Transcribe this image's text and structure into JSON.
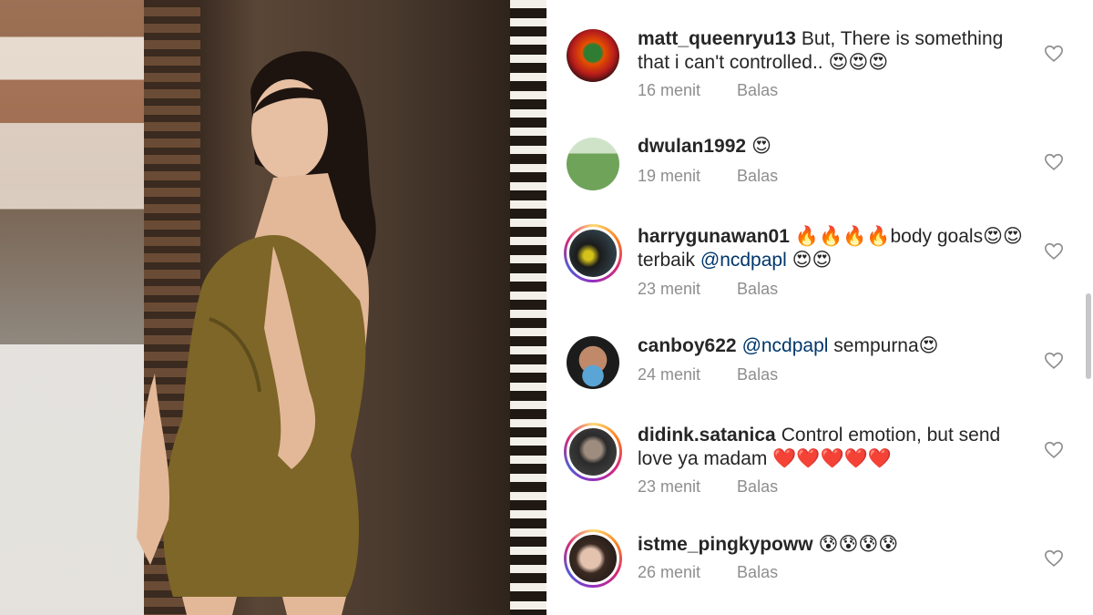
{
  "comments": [
    {
      "username": "matt_queenryu13",
      "segments": [
        {
          "text": "But, There is something that i can't controlled.. 😍😍😍"
        }
      ],
      "time": "16 menit",
      "reply": "Balas",
      "story_ring": false,
      "avatar": "red-fire-avatar"
    },
    {
      "username": "dwulan1992",
      "segments": [
        {
          "text": "😍"
        }
      ],
      "time": "19 menit",
      "reply": "Balas",
      "story_ring": false,
      "avatar": "child-on-grass-avatar"
    },
    {
      "username": "harrygunawan01",
      "segments": [
        {
          "text": "🔥🔥🔥🔥body goals😍😍 terbaik "
        },
        {
          "mention": "@ncdpapl"
        },
        {
          "text": " 😍😍"
        }
      ],
      "time": "23 menit",
      "reply": "Balas",
      "story_ring": true,
      "avatar": "motorcycle-avatar"
    },
    {
      "username": "canboy622",
      "segments": [
        {
          "mention": "@ncdpapl"
        },
        {
          "text": " sempurna😍"
        }
      ],
      "time": "24 menit",
      "reply": "Balas",
      "story_ring": false,
      "avatar": "masked-face-avatar"
    },
    {
      "username": "didink.satanica",
      "segments": [
        {
          "text": "Control emotion, but send love ya madam ❤️❤️❤️❤️❤️"
        }
      ],
      "time": "23 menit",
      "reply": "Balas",
      "story_ring": true,
      "avatar": "dark-portrait-avatar"
    },
    {
      "username": "istme_pingkypoww",
      "segments": [
        {
          "text": "😰😰😰😰"
        }
      ],
      "time": "26 menit",
      "reply": "Balas",
      "story_ring": true,
      "avatar": "girl-portrait-avatar"
    }
  ],
  "icons": {
    "like": "heart-outline-icon"
  },
  "colors": {
    "text": "#262626",
    "meta": "#8e8e8e",
    "mention": "#00376b",
    "heart": "#8e8e8e"
  }
}
